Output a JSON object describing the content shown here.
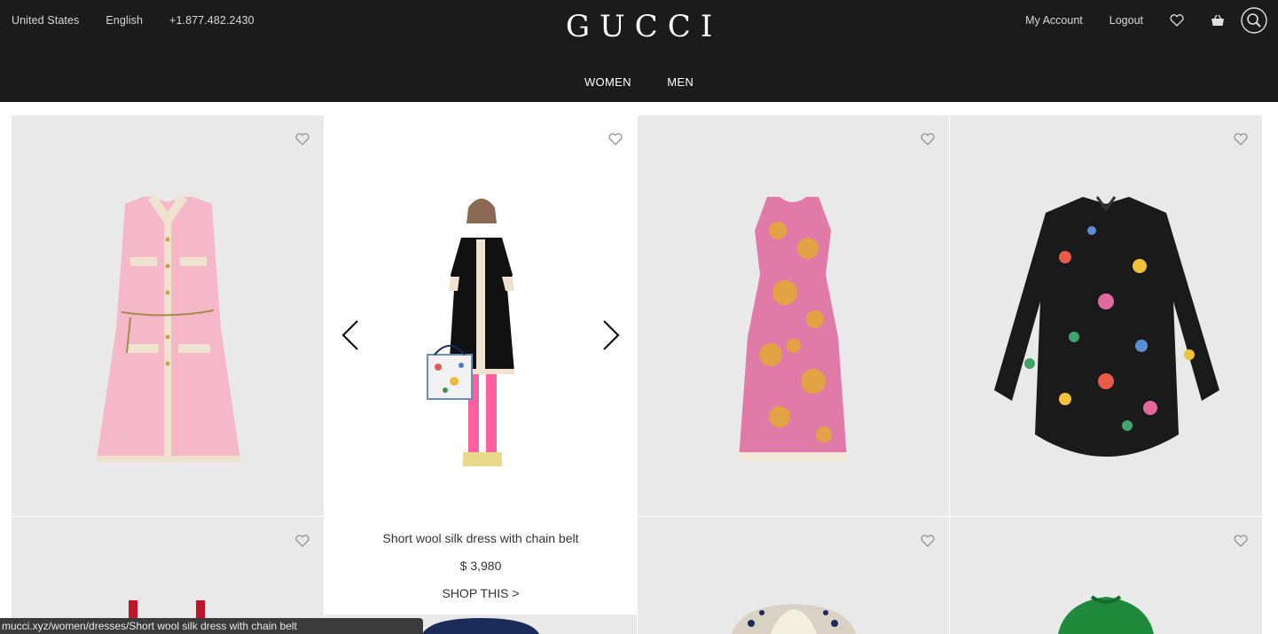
{
  "header": {
    "country": "United States",
    "language": "English",
    "phone": "+1.877.482.2430",
    "logo": "GUCCI",
    "my_account": "My Account",
    "logout": "Logout",
    "icons": [
      "heart-icon",
      "shopping-bag-icon",
      "search-icon"
    ]
  },
  "nav": {
    "women": "WOMEN",
    "men": "MEN"
  },
  "featured": {
    "name": "Short wool silk dress with chain belt",
    "price": "$ 3,980",
    "cta": "SHOP THIS >"
  },
  "status_bar": {
    "url": "mucci.xyz/women/dresses/Short wool silk dress with chain belt"
  },
  "colors": {
    "header_bg": "#1b1b1b",
    "tile_bg": "#e9e9e9",
    "dress_pink": "#f4b8c8",
    "dress_black": "#111111",
    "floral_shirt": "#1a1a1a",
    "green_dress": "#1f8a3b"
  }
}
